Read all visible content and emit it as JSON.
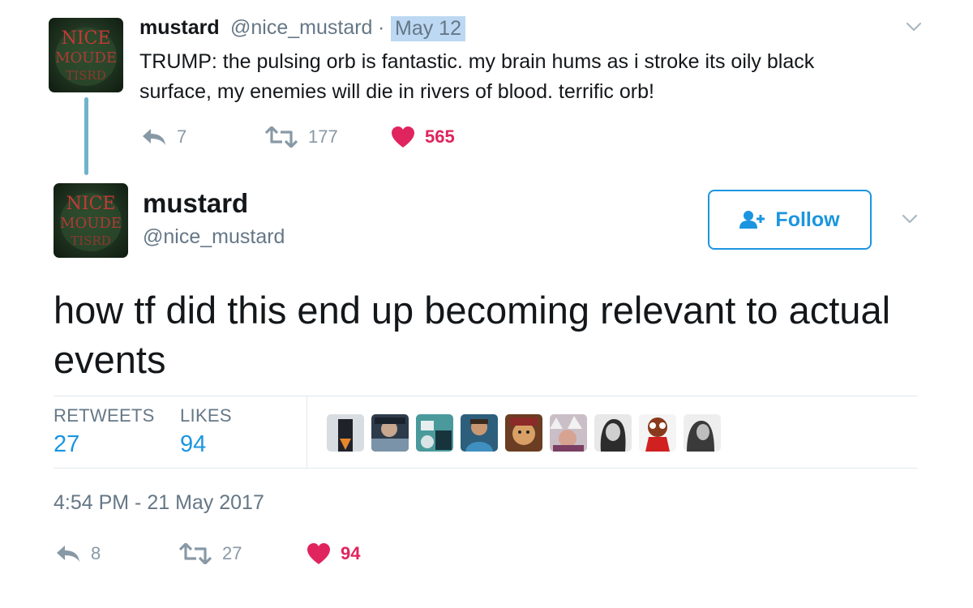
{
  "first_tweet": {
    "name": "mustard",
    "handle": "@nice_mustard",
    "separator": "·",
    "date": "May 12",
    "text": "TRUMP: the pulsing orb is fantastic. my brain hums as i stroke its oily black surface, my enemies will die in rivers of blood. terrific orb!",
    "replies": "7",
    "retweets": "177",
    "likes": "565",
    "avatar_text": "NICE MOUDE TISRD"
  },
  "main_tweet": {
    "name": "mustard",
    "handle": "@nice_mustard",
    "follow_label": "Follow",
    "text": "how tf did this end up becoming relevant to actual events",
    "stats": {
      "retweets_label": "RETWEETS",
      "retweets_value": "27",
      "likes_label": "LIKES",
      "likes_value": "94"
    },
    "liker_count": 9,
    "timestamp": "4:54 PM - 21 May 2017",
    "actions": {
      "replies": "8",
      "retweets": "27",
      "likes": "94"
    }
  },
  "colors": {
    "accent": "#1b95e0",
    "like": "#e0245e",
    "muted": "#657786",
    "thread_line": "#6fb3cc",
    "date_highlight": "#bcd8f2"
  },
  "icons": [
    "reply-icon",
    "retweet-icon",
    "heart-icon",
    "chevron-down-icon",
    "follow-person-icon"
  ]
}
